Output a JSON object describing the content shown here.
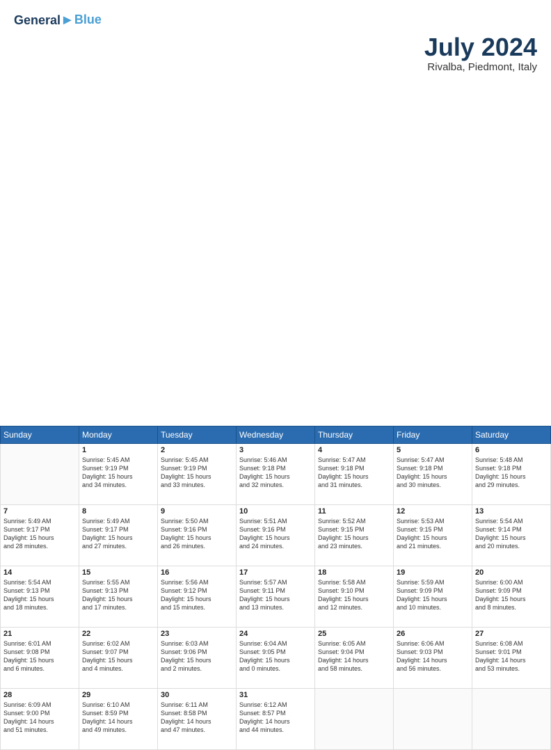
{
  "header": {
    "logo_line1": "General",
    "logo_line2": "Blue",
    "title": "July 2024",
    "subtitle": "Rivalba, Piedmont, Italy"
  },
  "days_of_week": [
    "Sunday",
    "Monday",
    "Tuesday",
    "Wednesday",
    "Thursday",
    "Friday",
    "Saturday"
  ],
  "weeks": [
    [
      {
        "day": "",
        "info": ""
      },
      {
        "day": "1",
        "info": "Sunrise: 5:45 AM\nSunset: 9:19 PM\nDaylight: 15 hours\nand 34 minutes."
      },
      {
        "day": "2",
        "info": "Sunrise: 5:45 AM\nSunset: 9:19 PM\nDaylight: 15 hours\nand 33 minutes."
      },
      {
        "day": "3",
        "info": "Sunrise: 5:46 AM\nSunset: 9:18 PM\nDaylight: 15 hours\nand 32 minutes."
      },
      {
        "day": "4",
        "info": "Sunrise: 5:47 AM\nSunset: 9:18 PM\nDaylight: 15 hours\nand 31 minutes."
      },
      {
        "day": "5",
        "info": "Sunrise: 5:47 AM\nSunset: 9:18 PM\nDaylight: 15 hours\nand 30 minutes."
      },
      {
        "day": "6",
        "info": "Sunrise: 5:48 AM\nSunset: 9:18 PM\nDaylight: 15 hours\nand 29 minutes."
      }
    ],
    [
      {
        "day": "7",
        "info": "Sunrise: 5:49 AM\nSunset: 9:17 PM\nDaylight: 15 hours\nand 28 minutes."
      },
      {
        "day": "8",
        "info": "Sunrise: 5:49 AM\nSunset: 9:17 PM\nDaylight: 15 hours\nand 27 minutes."
      },
      {
        "day": "9",
        "info": "Sunrise: 5:50 AM\nSunset: 9:16 PM\nDaylight: 15 hours\nand 26 minutes."
      },
      {
        "day": "10",
        "info": "Sunrise: 5:51 AM\nSunset: 9:16 PM\nDaylight: 15 hours\nand 24 minutes."
      },
      {
        "day": "11",
        "info": "Sunrise: 5:52 AM\nSunset: 9:15 PM\nDaylight: 15 hours\nand 23 minutes."
      },
      {
        "day": "12",
        "info": "Sunrise: 5:53 AM\nSunset: 9:15 PM\nDaylight: 15 hours\nand 21 minutes."
      },
      {
        "day": "13",
        "info": "Sunrise: 5:54 AM\nSunset: 9:14 PM\nDaylight: 15 hours\nand 20 minutes."
      }
    ],
    [
      {
        "day": "14",
        "info": "Sunrise: 5:54 AM\nSunset: 9:13 PM\nDaylight: 15 hours\nand 18 minutes."
      },
      {
        "day": "15",
        "info": "Sunrise: 5:55 AM\nSunset: 9:13 PM\nDaylight: 15 hours\nand 17 minutes."
      },
      {
        "day": "16",
        "info": "Sunrise: 5:56 AM\nSunset: 9:12 PM\nDaylight: 15 hours\nand 15 minutes."
      },
      {
        "day": "17",
        "info": "Sunrise: 5:57 AM\nSunset: 9:11 PM\nDaylight: 15 hours\nand 13 minutes."
      },
      {
        "day": "18",
        "info": "Sunrise: 5:58 AM\nSunset: 9:10 PM\nDaylight: 15 hours\nand 12 minutes."
      },
      {
        "day": "19",
        "info": "Sunrise: 5:59 AM\nSunset: 9:09 PM\nDaylight: 15 hours\nand 10 minutes."
      },
      {
        "day": "20",
        "info": "Sunrise: 6:00 AM\nSunset: 9:09 PM\nDaylight: 15 hours\nand 8 minutes."
      }
    ],
    [
      {
        "day": "21",
        "info": "Sunrise: 6:01 AM\nSunset: 9:08 PM\nDaylight: 15 hours\nand 6 minutes."
      },
      {
        "day": "22",
        "info": "Sunrise: 6:02 AM\nSunset: 9:07 PM\nDaylight: 15 hours\nand 4 minutes."
      },
      {
        "day": "23",
        "info": "Sunrise: 6:03 AM\nSunset: 9:06 PM\nDaylight: 15 hours\nand 2 minutes."
      },
      {
        "day": "24",
        "info": "Sunrise: 6:04 AM\nSunset: 9:05 PM\nDaylight: 15 hours\nand 0 minutes."
      },
      {
        "day": "25",
        "info": "Sunrise: 6:05 AM\nSunset: 9:04 PM\nDaylight: 14 hours\nand 58 minutes."
      },
      {
        "day": "26",
        "info": "Sunrise: 6:06 AM\nSunset: 9:03 PM\nDaylight: 14 hours\nand 56 minutes."
      },
      {
        "day": "27",
        "info": "Sunrise: 6:08 AM\nSunset: 9:01 PM\nDaylight: 14 hours\nand 53 minutes."
      }
    ],
    [
      {
        "day": "28",
        "info": "Sunrise: 6:09 AM\nSunset: 9:00 PM\nDaylight: 14 hours\nand 51 minutes."
      },
      {
        "day": "29",
        "info": "Sunrise: 6:10 AM\nSunset: 8:59 PM\nDaylight: 14 hours\nand 49 minutes."
      },
      {
        "day": "30",
        "info": "Sunrise: 6:11 AM\nSunset: 8:58 PM\nDaylight: 14 hours\nand 47 minutes."
      },
      {
        "day": "31",
        "info": "Sunrise: 6:12 AM\nSunset: 8:57 PM\nDaylight: 14 hours\nand 44 minutes."
      },
      {
        "day": "",
        "info": ""
      },
      {
        "day": "",
        "info": ""
      },
      {
        "day": "",
        "info": ""
      }
    ]
  ]
}
